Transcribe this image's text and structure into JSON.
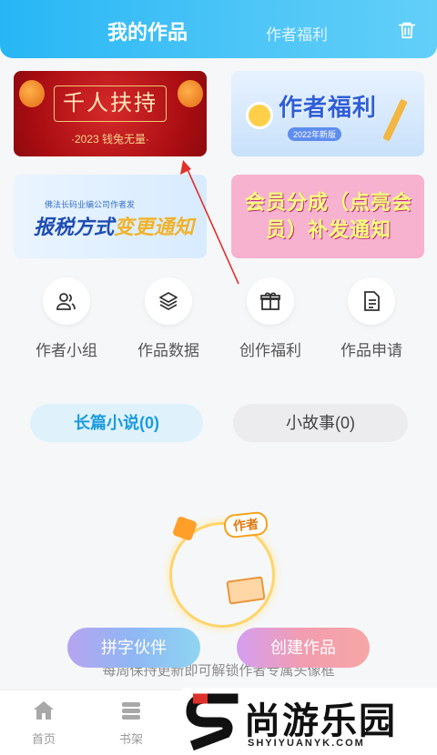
{
  "header": {
    "tab_works": "我的作品",
    "tab_welfare": "作者福利",
    "trash_icon": "trash-icon"
  },
  "banners": [
    {
      "title": "千人扶持",
      "subtitle": "·2023 钱兔无量·"
    },
    {
      "title": "作者福利",
      "subtitle": "2022年新版"
    },
    {
      "top": "佛法长码业编公司作者发",
      "title_a": "报税方式",
      "title_b": "变更通知"
    },
    {
      "title": "会员分成（点亮会员）补发通知"
    }
  ],
  "tools": [
    {
      "label": "作者小组",
      "icon": "people-icon"
    },
    {
      "label": "作品数据",
      "icon": "layers-icon"
    },
    {
      "label": "创作福利",
      "icon": "gift-icon"
    },
    {
      "label": "作品申请",
      "icon": "document-icon"
    }
  ],
  "categories": {
    "novel": "长篇小说(0)",
    "story": "小故事(0)"
  },
  "medal": {
    "tag": "作者"
  },
  "hint": "每周保持更新即可解锁作者专属头像框",
  "buttons": {
    "partner": "拼字伙伴",
    "create": "创建作品"
  },
  "nav": {
    "home": "首页",
    "shelf": "书架"
  },
  "watermark": {
    "main": "尚游乐园",
    "sub": "SHYIYUANYK.COM"
  },
  "colors": {
    "header": "#27b6f5",
    "accent_blue": "#1b9be0",
    "arrow": "#e0302a"
  }
}
